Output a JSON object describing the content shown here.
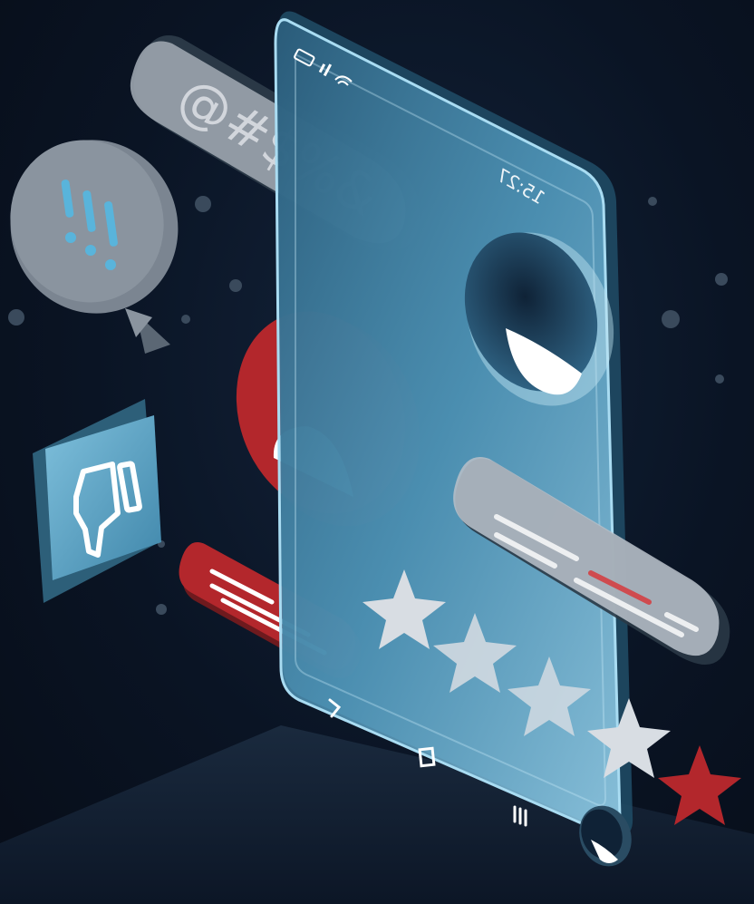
{
  "phone": {
    "time": "15:27",
    "status_icons": [
      "battery-icon",
      "signal-bars-icon",
      "wifi-icon"
    ],
    "nav_icons": [
      "back-chevron-icon",
      "home-square-icon",
      "recents-lines-icon"
    ]
  },
  "bubbles": {
    "symbols_text": "@#$%&",
    "exclamation_text": "!!!"
  },
  "rating": {
    "stars_total": 5,
    "stars_highlighted": 1,
    "highlight_color": "#b3272c",
    "star_color": "#d8dde3"
  },
  "colors": {
    "background": "#0a1424",
    "glass": "#6fb3d6",
    "accent_red": "#b3272c",
    "bubble_gray": "#9aa3ad",
    "thumb_tile": "#5ea5c6"
  }
}
